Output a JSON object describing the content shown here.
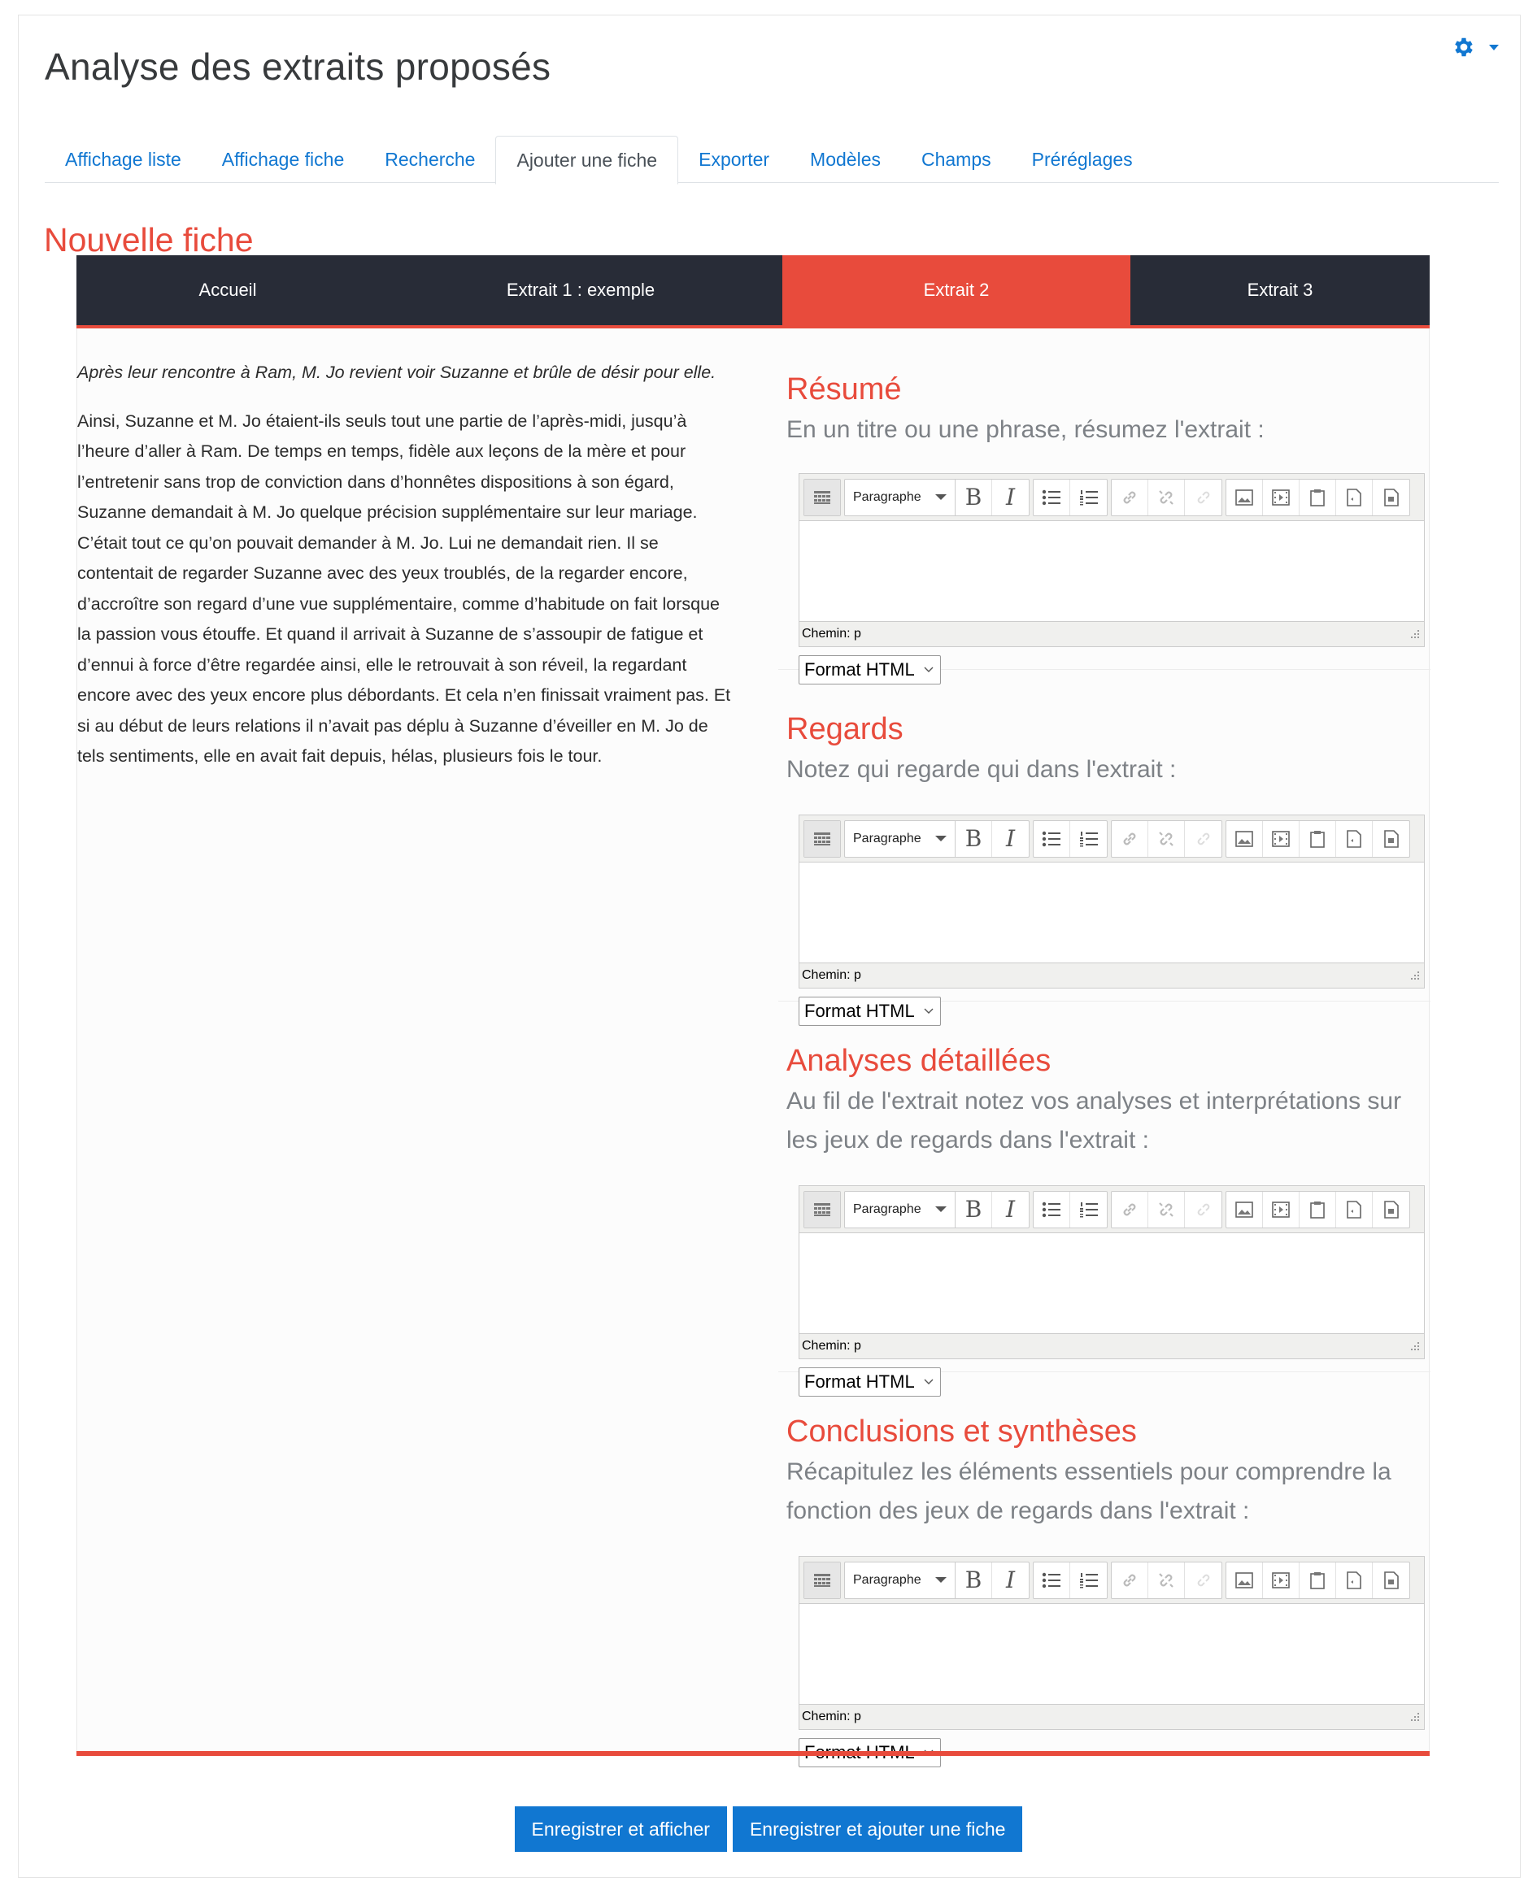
{
  "page": {
    "title": "Analyse des extraits proposés"
  },
  "settings": {
    "icon": "gear-icon"
  },
  "tabs": [
    {
      "label": "Affichage liste",
      "active": false
    },
    {
      "label": "Affichage fiche",
      "active": false
    },
    {
      "label": "Recherche",
      "active": false
    },
    {
      "label": "Ajouter une fiche",
      "active": true
    },
    {
      "label": "Exporter",
      "active": false
    },
    {
      "label": "Modèles",
      "active": false
    },
    {
      "label": "Champs",
      "active": false
    },
    {
      "label": "Préréglages",
      "active": false
    }
  ],
  "section": {
    "title": "Nouvelle fiche"
  },
  "steps": [
    {
      "label": "Accueil",
      "active": false
    },
    {
      "label": "Extrait 1 : exemple",
      "active": false
    },
    {
      "label": "Extrait 2",
      "active": true
    },
    {
      "label": "Extrait 3",
      "active": false
    }
  ],
  "excerpt": {
    "lead": "Après leur rencontre à Ram, M. Jo revient voir Suzanne et brûle de désir pour elle.",
    "body": "Ainsi, Suzanne et M. Jo étaient-ils seuls tout une partie de l’après-midi, jusqu’à l’heure d’aller à Ram. De temps en temps, fidèle aux leçons de la mère et pour l’entretenir sans trop de conviction dans d’honnêtes dispositions à son égard, Suzanne demandait à M. Jo quelque précision supplémentaire sur leur mariage. C’était tout ce qu’on pouvait demander à M. Jo. Lui ne demandait rien. Il se contentait de regarder Suzanne avec des yeux troublés, de la regarder encore, d’accroître son regard d’une vue supplémentaire, comme d’habitude on fait lorsque la passion vous étouffe. Et quand il arrivait à Suzanne de s’assoupir de fatigue et d’ennui à force d’être regardée ainsi, elle le retrouvait à son réveil, la regardant encore avec des yeux encore plus débordants. Et cela n’en finissait vraiment pas. Et si au début de leurs relations il n’avait pas déplu à Suzanne d’éveiller en M. Jo de tels sentiments, elle en avait fait depuis, hélas, plusieurs fois le tour."
  },
  "editor": {
    "format_label": "Paragraphe",
    "status": "Chemin: p",
    "text_format": "Format HTML"
  },
  "fields": [
    {
      "title": "Résumé",
      "prompt": "En un titre ou une phrase, résumez l'extrait :"
    },
    {
      "title": "Regards",
      "prompt": "Notez qui regarde qui dans l'extrait :"
    },
    {
      "title": "Analyses détaillées",
      "prompt": "Au fil de l'extrait notez vos analyses et interprétations sur les jeux de regards dans l'extrait :"
    },
    {
      "title": "Conclusions et synthèses",
      "prompt": "Récapitulez les éléments essentiels pour comprendre la fonction des jeux de regards dans l'extrait :"
    }
  ],
  "buttons": {
    "save_view": "Enregistrer et afficher",
    "save_add": "Enregistrer et ajouter une fiche"
  },
  "colors": {
    "accent": "#e84b3c",
    "link": "#1177d1",
    "nav_bg": "#282c37"
  }
}
